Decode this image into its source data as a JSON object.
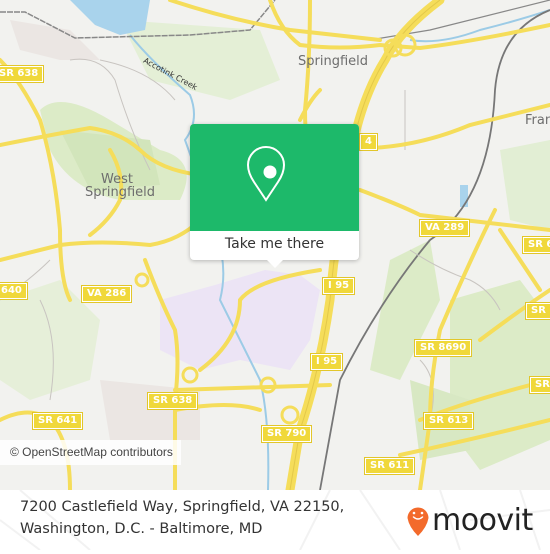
{
  "map": {
    "place_labels": [
      {
        "id": "springfield",
        "text": "Springfield"
      },
      {
        "id": "west-springfield-1",
        "text": "West"
      },
      {
        "id": "west-springfield-2",
        "text": "Springfield"
      },
      {
        "id": "franconia",
        "text": "Fran"
      }
    ],
    "water_labels": [
      {
        "id": "accotink-creek",
        "text": "Accotink Creek"
      }
    ],
    "route_shields": [
      {
        "id": "sr-638-nw",
        "text": "SR 638"
      },
      {
        "id": "sr-640",
        "text": "640"
      },
      {
        "id": "va-286",
        "text": "VA 286"
      },
      {
        "id": "sr-638-s",
        "text": "SR 638"
      },
      {
        "id": "sr-641",
        "text": "SR 641"
      },
      {
        "id": "sr-790",
        "text": "SR 790"
      },
      {
        "id": "i95-n",
        "text": "I 95"
      },
      {
        "id": "i95-s",
        "text": "I 95"
      },
      {
        "id": "va-289",
        "text": "VA 289"
      },
      {
        "id": "sr-8690",
        "text": "SR 8690"
      },
      {
        "id": "sr-613",
        "text": "SR 613"
      },
      {
        "id": "sr-611",
        "text": "SR 611"
      },
      {
        "id": "sr-e1",
        "text": "SR 6"
      },
      {
        "id": "sr-e2",
        "text": "SR"
      },
      {
        "id": "sr-e3",
        "text": "SR"
      },
      {
        "id": "i644",
        "text": "4"
      }
    ],
    "attribution": "© OpenStreetMap contributors"
  },
  "popup": {
    "icon": "map-pin-icon",
    "button_label": "Take me there"
  },
  "footer": {
    "address_line1": "7200 Castlefield Way, Springfield, VA 22150,",
    "address_line2": "Washington, D.C. - Baltimore, MD",
    "logo_text": "moovit",
    "logo_icon": "moovit-smiley-pin-icon"
  },
  "colors": {
    "popup_green": "#1db96a",
    "road_yellow": "#f5dd5a",
    "water_blue": "#a9d3ec",
    "park_green": "#d8e8c3",
    "military_purple": "#ece4f5",
    "moovit_orange": "#f36a2b"
  }
}
